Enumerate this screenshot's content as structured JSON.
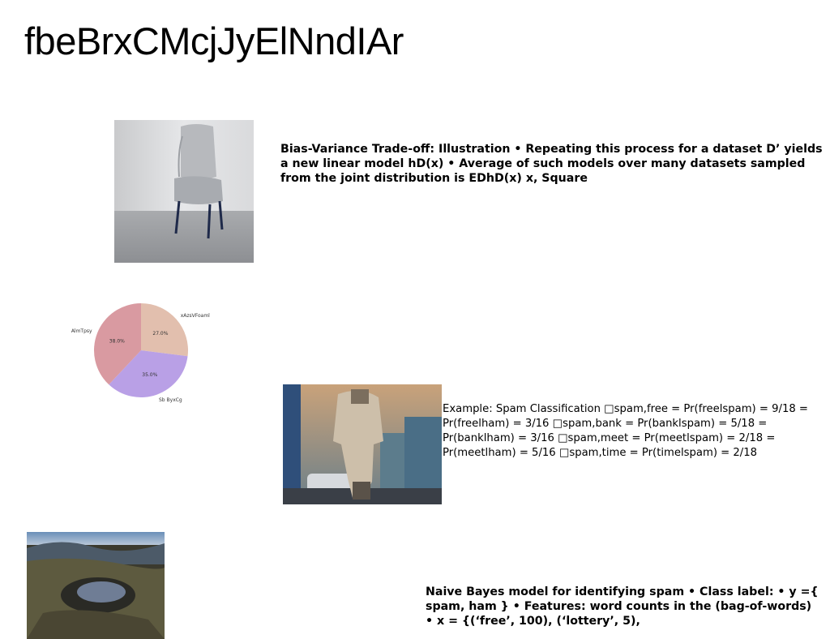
{
  "title": "fbeBrxCMcjJyElNndIAr",
  "blocks": {
    "bias_variance": "Bias-Variance Trade-off: Illustration • Repeating this process for a dataset D’ yields a new linear model hD(x) • Average of such models over many datasets sampled from the joint distribution is EDhD(x) x, Square",
    "spam_example": "Example: Spam Classification □spam,free = Pr(freelspam) = 9/18 = Pr(freelham) = 3/16 □spam,bank = Pr(banklspam) = 5/18 = Pr(banklham) = 3/16 □spam,meet = Pr(meetlspam) = 2/18 = Pr(meetlham) = 5/16 □spam,time = Pr(timelspam) = 2/18",
    "naive_bayes": "Naive Bayes model for identifying spam • Class label: • y ={ spam, ham } • Features: word counts in the (bag-of-words) • x = {(‘free’, 100), (‘lottery’, 5),"
  },
  "images": {
    "chair": "armchair photo",
    "street": "person in street photo",
    "crater": "volcanic crater photo"
  },
  "chart_data": {
    "type": "pie",
    "slices": [
      {
        "label": "xAzsVFoaml",
        "value": 27.0,
        "pct_label": "27.0%",
        "color": "#e2bfae"
      },
      {
        "label": "Sb ByxCg",
        "value": 35.0,
        "pct_label": "35.0%",
        "color": "#b9a0e6"
      },
      {
        "label": "AlmTpsy",
        "value": 38.0,
        "pct_label": "38.0%",
        "color": "#d99aa1"
      }
    ]
  }
}
